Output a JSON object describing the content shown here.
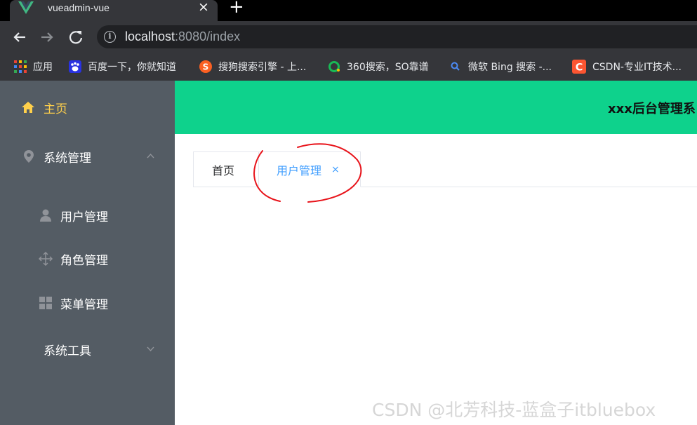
{
  "browser": {
    "tab_title": "vueadmin-vue",
    "tab_close": "×",
    "new_tab": "+",
    "url_host": "localhost",
    "url_rest": ":8080/index"
  },
  "bookmarks": [
    {
      "label": "应用",
      "icon": "apps-grid-icon"
    },
    {
      "label": "百度一下，你就知道",
      "icon": "baidu-icon"
    },
    {
      "label": "搜狗搜索引擎 - 上...",
      "icon": "sogou-icon"
    },
    {
      "label": "360搜索，SO靠谱",
      "icon": "360-search-icon"
    },
    {
      "label": "微软 Bing 搜索 -...",
      "icon": "bing-search-icon"
    },
    {
      "label": "CSDN-专业IT技术...",
      "icon": "csdn-icon"
    }
  ],
  "sidebar": {
    "home": "主页",
    "system_management": "系统管理",
    "user_management": "用户管理",
    "role_management": "角色管理",
    "menu_management": "菜单管理",
    "system_tools": "系统工具",
    "active_color": "#ffd04b",
    "background": "#545c64"
  },
  "header": {
    "title": "xxx后台管理系",
    "background": "#0ed28c"
  },
  "tabs": {
    "home": "首页",
    "user_management": "用户管理",
    "close": "×",
    "active_color": "#409eff"
  },
  "watermark": "CSDN @北芳科技-蓝盒子itbluebox"
}
